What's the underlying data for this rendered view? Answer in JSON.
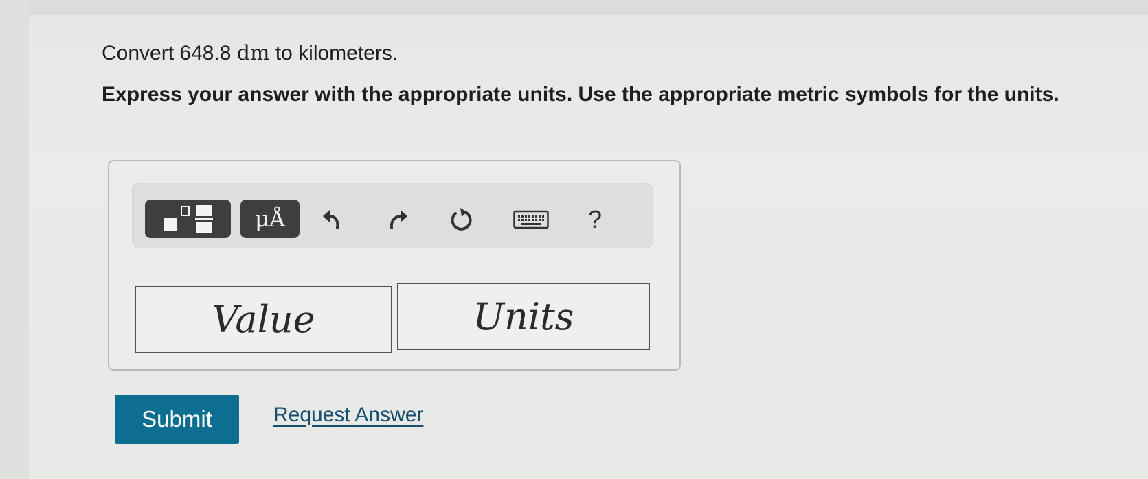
{
  "question": {
    "prefix": "Convert 648.8",
    "unit": "dm",
    "suffix": "to kilometers."
  },
  "instruction": "Express your answer with the appropriate units. Use the appropriate metric symbols for the units.",
  "toolbar": {
    "templates_icon": "templates-icon",
    "units_label": "μÅ",
    "undo_icon": "undo-icon",
    "redo_icon": "redo-icon",
    "reset_icon": "reset-icon",
    "keyboard_icon": "keyboard-icon",
    "help_label": "?"
  },
  "answer": {
    "value_placeholder": "Value",
    "units_placeholder": "Units"
  },
  "actions": {
    "submit_label": "Submit",
    "request_answer_label": "Request Answer"
  },
  "colors": {
    "submit_bg": "#0e6e92",
    "link": "#16506e",
    "toolbar_button": "#3e3e3e"
  }
}
